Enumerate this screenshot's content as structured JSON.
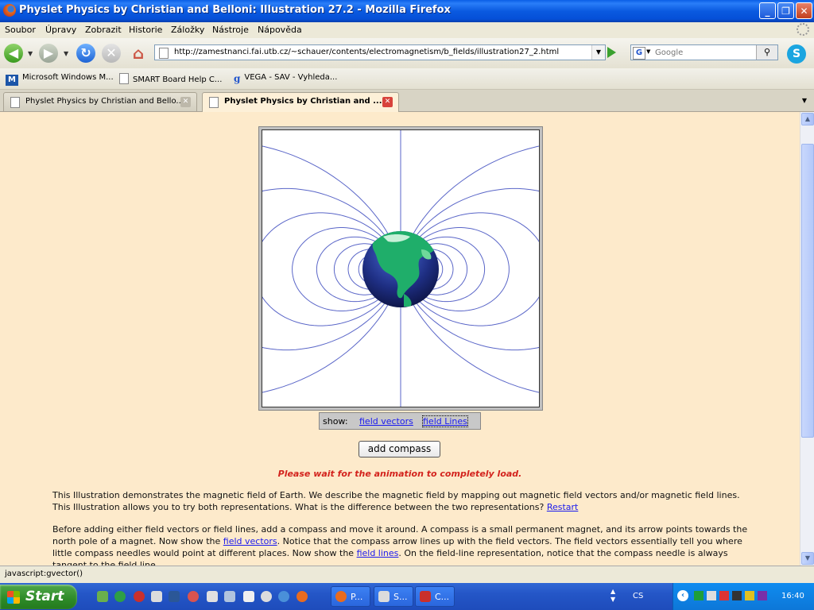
{
  "window": {
    "title": "Physlet Physics by Christian and Belloni: Illustration 27.2 - Mozilla Firefox"
  },
  "menu": [
    "Soubor",
    "Úpravy",
    "Zobrazit",
    "Historie",
    "Záložky",
    "Nástroje",
    "Nápověda"
  ],
  "nav": {
    "url": "http://zamestnanci.fai.utb.cz/~schauer/contents/electromagnetism/b_fields/illustration27_2.html",
    "search_placeholder": "Google",
    "search_engine_letter": "G"
  },
  "bookmarks": [
    {
      "label": "Microsoft Windows M...",
      "icon": "msn-icon"
    },
    {
      "label": "SMART Board Help C...",
      "icon": "page-icon"
    },
    {
      "label": "VEGA - SAV - Vyhleda...",
      "icon": "google-icon"
    }
  ],
  "tabs": [
    {
      "label": "Physlet Physics by Christian and Bello...",
      "active": false
    },
    {
      "label": "Physlet Physics by Christian and ...",
      "active": true
    }
  ],
  "content": {
    "show_label": "show:",
    "field_vectors": "field vectors",
    "field_lines": "field Lines",
    "add_compass": "add compass",
    "wait_message": "Please wait for the animation to completely load.",
    "para1_text": "This Illustration demonstrates the magnetic field of Earth.  We describe the magnetic field by mapping out magnetic field vectors and/or magnetic field lines. This Illustration allows you to try both representations.  What is the difference between the two representations? ",
    "restart": "Restart",
    "para2_a": "Before adding either field vectors or field lines, add a compass and move it around.  A compass is a small permanent magnet, and its arrow points towards the north pole of a magnet.  Now show the ",
    "para2_link1": "field vectors",
    "para2_b": ".  Notice that the compass arrow lines up with the field vectors.  The field vectors essentially tell you where little compass needles would point at different places.  Now show the ",
    "para2_link2": "field lines",
    "para2_c": ".  On the field-line representation, notice that the compass needle is always tangent to the field line."
  },
  "status": "javascript:gvector()",
  "taskbar": {
    "start": "Start",
    "tasks": [
      {
        "label": "P..."
      },
      {
        "label": "S..."
      },
      {
        "label": "C..."
      }
    ],
    "lang": "CS",
    "clock": "16:40"
  },
  "colors": {
    "page_bg": "#fdeacb",
    "field_line": "#5a66c8",
    "link": "#1a1aee",
    "warning": "#d3231d"
  }
}
